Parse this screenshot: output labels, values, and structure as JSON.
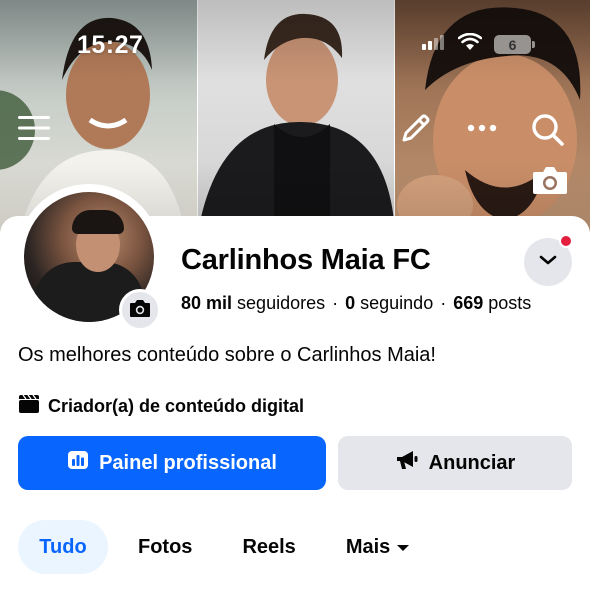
{
  "status_bar": {
    "time": "15:27",
    "battery": "6"
  },
  "cover": {
    "menu_icon": "hamburger-icon",
    "edit_icon": "pencil-icon",
    "more_icon": "more-dots-icon",
    "search_icon": "search-icon",
    "camera_icon": "camera-icon"
  },
  "profile": {
    "name": "Carlinhos Maia FC",
    "stats": {
      "followers_value": "80 mil",
      "followers_label": "seguidores",
      "following_value": "0",
      "following_label": "seguindo",
      "posts_value": "669",
      "posts_label": "posts",
      "separator": "·"
    },
    "bio": "Os melhores conteúdo sobre o Carlinhos Maia!",
    "category": "Criador(a) de conteúdo digital"
  },
  "actions": {
    "primary_label": "Painel profissional",
    "secondary_label": "Anunciar"
  },
  "tabs": [
    {
      "label": "Tudo",
      "active": true
    },
    {
      "label": "Fotos",
      "active": false
    },
    {
      "label": "Reels",
      "active": false
    },
    {
      "label": "Mais",
      "active": false
    }
  ],
  "colors": {
    "accent": "#0866ff",
    "tab_active_bg": "#ebf5ff",
    "secondary_bg": "#e4e6eb",
    "notification": "#e41e3f"
  }
}
